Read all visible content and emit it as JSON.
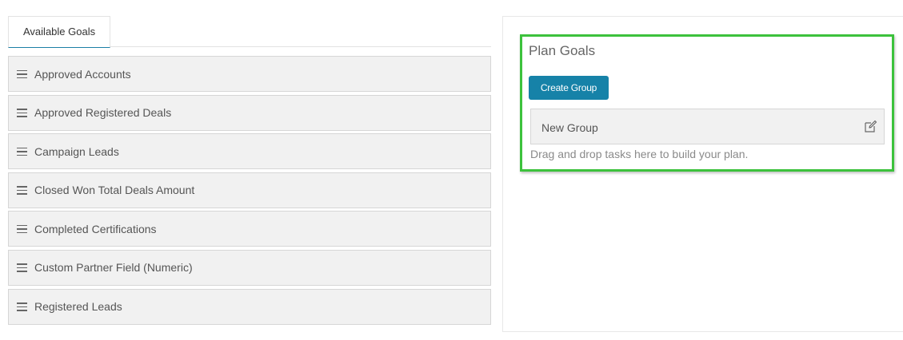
{
  "tabs": {
    "available_goals": "Available Goals"
  },
  "available_goals": [
    "Approved Accounts",
    "Approved Registered Deals",
    "Campaign Leads",
    "Closed Won Total Deals Amount",
    "Completed Certifications",
    "Custom Partner Field (Numeric)",
    "Registered Leads"
  ],
  "plan": {
    "title": "Plan Goals",
    "create_group_label": "Create Group",
    "group_name": "New Group",
    "drop_hint": "Drag and drop tasks here to build your plan."
  },
  "icons": {
    "drag_handle": "hamburger-icon",
    "edit": "edit-icon"
  },
  "colors": {
    "primary_button": "#1682a8",
    "highlight_border": "#3cc23c"
  }
}
